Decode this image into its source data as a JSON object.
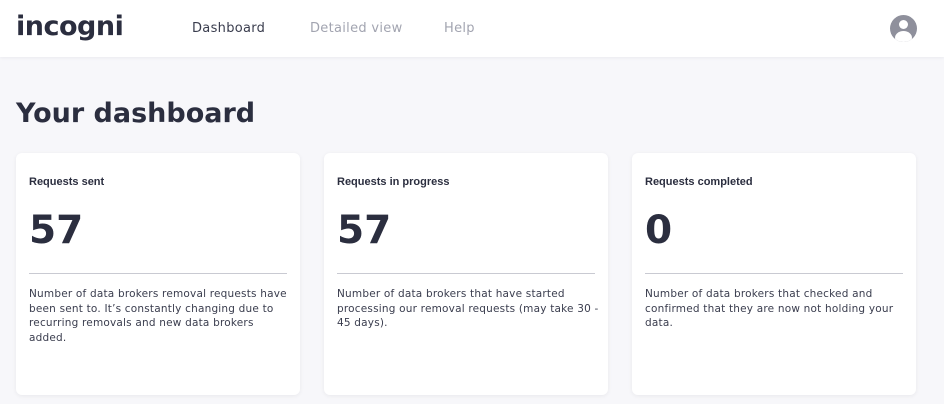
{
  "header": {
    "logo_text": "incogni",
    "nav": [
      {
        "label": "Dashboard",
        "active": true
      },
      {
        "label": "Detailed view",
        "active": false
      },
      {
        "label": "Help",
        "active": false
      }
    ],
    "avatar_icon": "user-avatar-icon"
  },
  "main": {
    "title": "Your dashboard",
    "cards": [
      {
        "title": "Requests sent",
        "value": "57",
        "description": "Number of data brokers removal requests have been sent to. It’s constantly changing due to recurring removals and new data brokers added."
      },
      {
        "title": "Requests in progress",
        "value": "57",
        "description": "Number of data brokers that have started processing our removal requests (may take 30 - 45 days)."
      },
      {
        "title": "Requests completed",
        "value": "0",
        "description": "Number of data brokers that checked and confirmed that they are now not holding your data."
      }
    ]
  },
  "colors": {
    "background": "#f7f7fa",
    "card": "#ffffff",
    "text_primary": "#2b2e3f",
    "nav_inactive": "#a2a4b0",
    "avatar": "#8f909c"
  }
}
